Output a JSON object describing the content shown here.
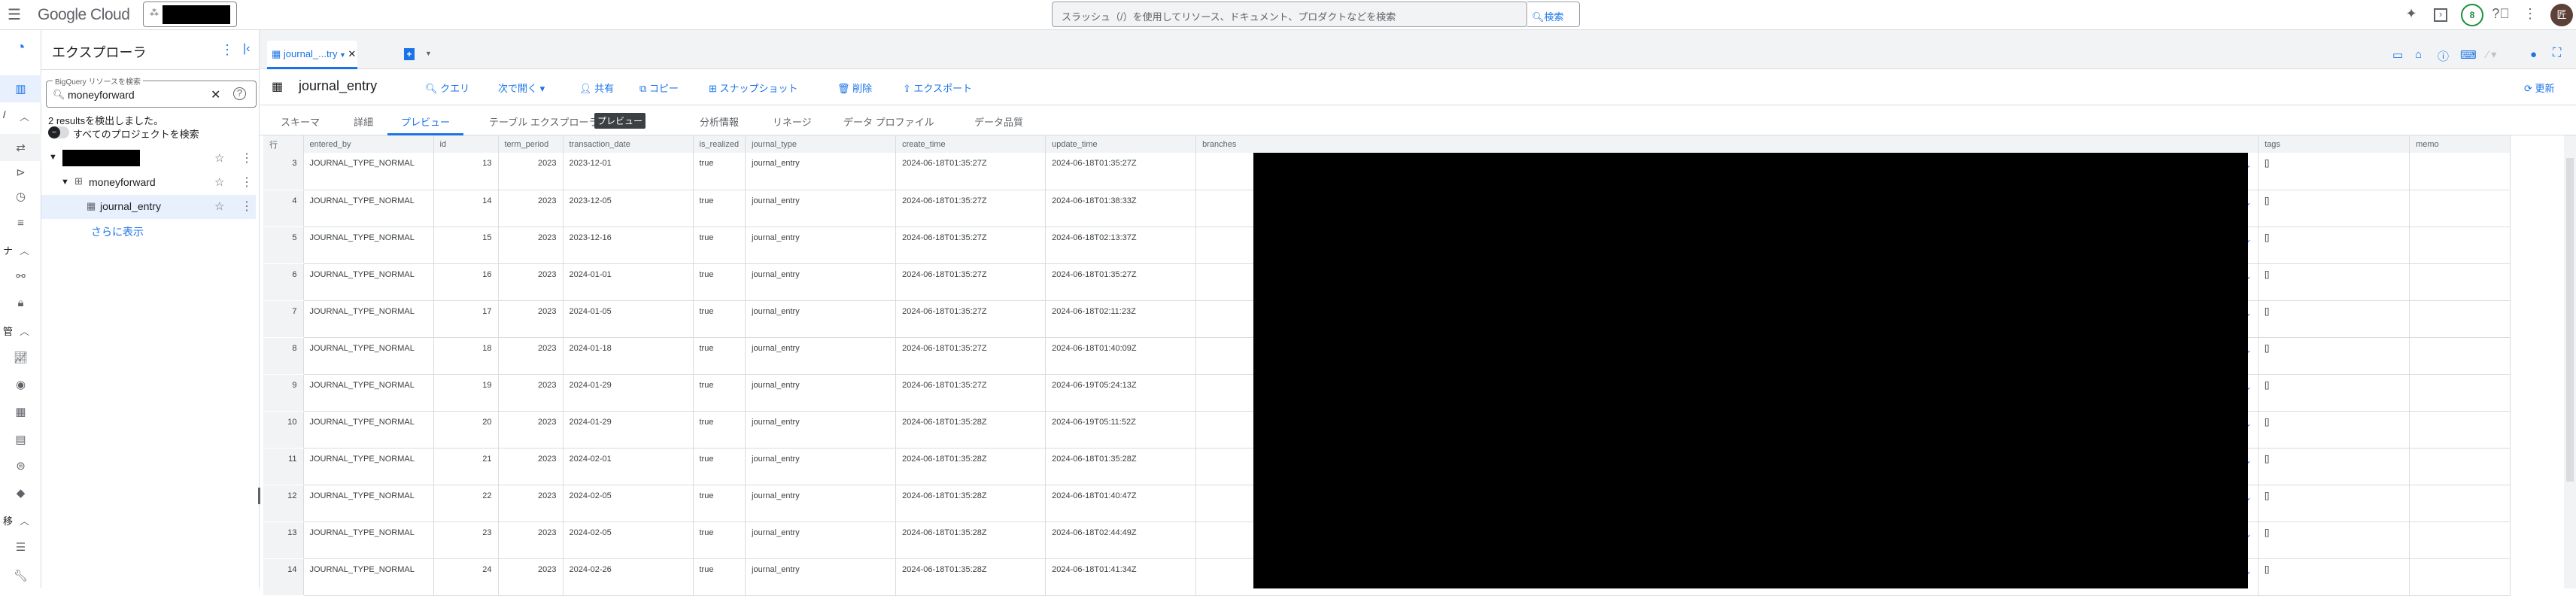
{
  "topbar": {
    "brand": "Google Cloud",
    "search_placeholder": "スラッシュ（/）を使用してリソース、ドキュメント、プロダクトなどを検索",
    "search_button": "検索",
    "notification_count": "8",
    "avatar_initial": "匠"
  },
  "rail": {
    "sections": [
      {
        "label": "/"
      },
      {
        "label": "ナ"
      },
      {
        "label": "管"
      },
      {
        "label": "移"
      }
    ]
  },
  "explorer": {
    "title": "エクスプローラ",
    "search_label": "BigQuery リソースを検索",
    "search_value": "moneyforward",
    "results_text": "2 resultsを検出しました。",
    "all_projects_toggle": "すべてのプロジェクトを検索",
    "dataset": "moneyforward",
    "table": "journal_entry",
    "show_more": "さらに表示"
  },
  "tabs": [
    {
      "label": "journal_...try",
      "active": true
    }
  ],
  "toolbar": {
    "title": "journal_entry",
    "query": "クエリ",
    "open_in": "次で開く",
    "share": "共有",
    "copy": "コピー",
    "snapshot": "スナップショット",
    "delete": "削除",
    "export": "エクスポート",
    "refresh": "更新"
  },
  "subtabs": [
    {
      "label": "スキーマ"
    },
    {
      "label": "詳細"
    },
    {
      "label": "プレビュー",
      "active": true
    },
    {
      "label": "テーブル エクスプローラ"
    },
    {
      "label": "プレビュー",
      "badge": true
    },
    {
      "label": "分析情報"
    },
    {
      "label": "リネージ"
    },
    {
      "label": "データ プロファイル"
    },
    {
      "label": "データ品質"
    }
  ],
  "colors": {
    "accent": "#1a73e8",
    "badge_bg": "#3c4043",
    "header_bg": "#f1f3f4"
  },
  "table": {
    "columns": [
      "行",
      "entered_by",
      "id",
      "term_period",
      "transaction_date",
      "is_realized",
      "journal_type",
      "create_time",
      "update_time",
      "branches",
      "tags",
      "memo"
    ],
    "rows": [
      {
        "row": "3",
        "entered_by": "JOURNAL_TYPE_NORMAL",
        "id": "13",
        "term_period": "2023",
        "transaction_date": "2023-12-01",
        "is_realized": "true",
        "journal_type": "journal_entry",
        "create_time": "2024-06-18T01:35:27Z",
        "update_time": "2024-06-18T01:35:27Z",
        "tags": "[]",
        "memo": ""
      },
      {
        "row": "4",
        "entered_by": "JOURNAL_TYPE_NORMAL",
        "id": "14",
        "term_period": "2023",
        "transaction_date": "2023-12-05",
        "is_realized": "true",
        "journal_type": "journal_entry",
        "create_time": "2024-06-18T01:35:27Z",
        "update_time": "2024-06-18T01:38:33Z",
        "tags": "[]",
        "memo": ""
      },
      {
        "row": "5",
        "entered_by": "JOURNAL_TYPE_NORMAL",
        "id": "15",
        "term_period": "2023",
        "transaction_date": "2023-12-16",
        "is_realized": "true",
        "journal_type": "journal_entry",
        "create_time": "2024-06-18T01:35:27Z",
        "update_time": "2024-06-18T02:13:37Z",
        "tags": "[]",
        "memo": ""
      },
      {
        "row": "6",
        "entered_by": "JOURNAL_TYPE_NORMAL",
        "id": "16",
        "term_period": "2023",
        "transaction_date": "2024-01-01",
        "is_realized": "true",
        "journal_type": "journal_entry",
        "create_time": "2024-06-18T01:35:27Z",
        "update_time": "2024-06-18T01:35:27Z",
        "tags": "[]",
        "memo": ""
      },
      {
        "row": "7",
        "entered_by": "JOURNAL_TYPE_NORMAL",
        "id": "17",
        "term_period": "2023",
        "transaction_date": "2024-01-05",
        "is_realized": "true",
        "journal_type": "journal_entry",
        "create_time": "2024-06-18T01:35:27Z",
        "update_time": "2024-06-18T02:11:23Z",
        "tags": "[]",
        "memo": ""
      },
      {
        "row": "8",
        "entered_by": "JOURNAL_TYPE_NORMAL",
        "id": "18",
        "term_period": "2023",
        "transaction_date": "2024-01-18",
        "is_realized": "true",
        "journal_type": "journal_entry",
        "create_time": "2024-06-18T01:35:27Z",
        "update_time": "2024-06-18T01:40:09Z",
        "tags": "[]",
        "memo": ""
      },
      {
        "row": "9",
        "entered_by": "JOURNAL_TYPE_NORMAL",
        "id": "19",
        "term_period": "2023",
        "transaction_date": "2024-01-29",
        "is_realized": "true",
        "journal_type": "journal_entry",
        "create_time": "2024-06-18T01:35:27Z",
        "update_time": "2024-06-19T05:24:13Z",
        "tags": "[]",
        "memo": ""
      },
      {
        "row": "10",
        "entered_by": "JOURNAL_TYPE_NORMAL",
        "id": "20",
        "term_period": "2023",
        "transaction_date": "2024-01-29",
        "is_realized": "true",
        "journal_type": "journal_entry",
        "create_time": "2024-06-18T01:35:28Z",
        "update_time": "2024-06-19T05:11:52Z",
        "tags": "[]",
        "memo": ""
      },
      {
        "row": "11",
        "entered_by": "JOURNAL_TYPE_NORMAL",
        "id": "21",
        "term_period": "2023",
        "transaction_date": "2024-02-01",
        "is_realized": "true",
        "journal_type": "journal_entry",
        "create_time": "2024-06-18T01:35:28Z",
        "update_time": "2024-06-18T01:35:28Z",
        "tags": "[]",
        "memo": ""
      },
      {
        "row": "12",
        "entered_by": "JOURNAL_TYPE_NORMAL",
        "id": "22",
        "term_period": "2023",
        "transaction_date": "2024-02-05",
        "is_realized": "true",
        "journal_type": "journal_entry",
        "create_time": "2024-06-18T01:35:28Z",
        "update_time": "2024-06-18T01:40:47Z",
        "tags": "[]",
        "memo": ""
      },
      {
        "row": "13",
        "entered_by": "JOURNAL_TYPE_NORMAL",
        "id": "23",
        "term_period": "2023",
        "transaction_date": "2024-02-05",
        "is_realized": "true",
        "journal_type": "journal_entry",
        "create_time": "2024-06-18T01:35:28Z",
        "update_time": "2024-06-18T02:44:49Z",
        "tags": "[]",
        "memo": ""
      },
      {
        "row": "14",
        "entered_by": "JOURNAL_TYPE_NORMAL",
        "id": "24",
        "term_period": "2023",
        "transaction_date": "2024-02-26",
        "is_realized": "true",
        "journal_type": "journal_entry",
        "create_time": "2024-06-18T01:35:28Z",
        "update_time": "2024-06-18T01:41:34Z",
        "tags": "[]",
        "memo": ""
      }
    ]
  }
}
